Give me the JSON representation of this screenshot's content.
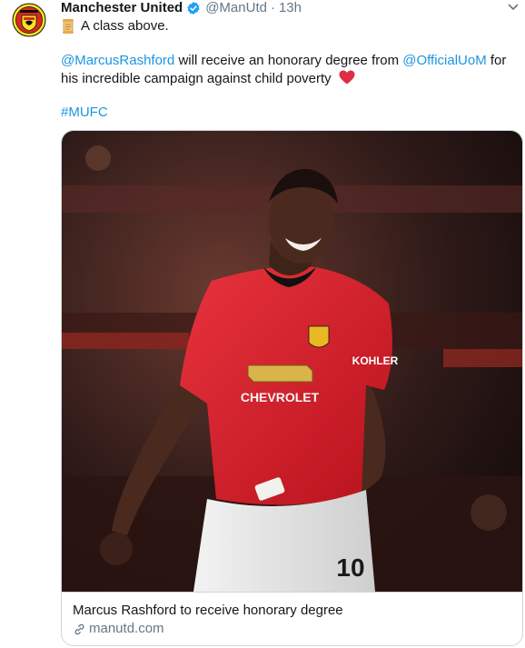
{
  "tweet": {
    "author_name": "Manchester United",
    "handle": "@ManUtd",
    "separator": "·",
    "time": "13h",
    "line1": "A class above.",
    "mention_1": "@MarcusRashford",
    "text_mid": " will receive an honorary degree from ",
    "mention_2": "@OfficialUoM",
    "text_tail_1": " for",
    "text_line_2": "his incredible campaign against child poverty",
    "hashtag": "#MUFC"
  },
  "card": {
    "title": "Marcus Rashford to receive honorary degree",
    "domain": "manutd.com",
    "image_shirt_sponsor": "CHEVROLET",
    "image_sleeve_sponsor": "KOHLER",
    "image_shirt_number": "10"
  },
  "icons": {
    "avatar": "manutd-crest-icon",
    "verified": "verified-badge-icon",
    "caret": "chevron-down-icon",
    "scroll_emoji": "scroll-emoji-icon",
    "heart": "red-heart-emoji-icon",
    "link": "link-icon"
  },
  "colors": {
    "link": "#1b95e0",
    "secondary_text": "#657786",
    "border": "#ccd6dd",
    "jersey_red": "#d6202c"
  }
}
